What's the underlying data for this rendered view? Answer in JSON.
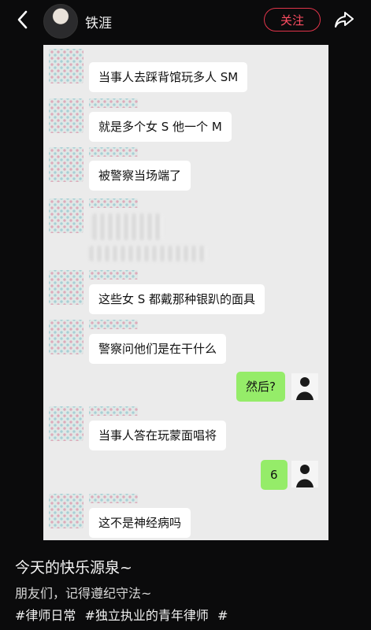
{
  "header": {
    "username": "铁涯",
    "follow_label": "关注"
  },
  "chat": {
    "messages": [
      {
        "side": "left",
        "text": "当事人去踩背馆玩多人 SM"
      },
      {
        "side": "left",
        "text": "就是多个女 S 他一个 M"
      },
      {
        "side": "left",
        "text": "被警察当场端了"
      },
      {
        "side": "left",
        "text": "",
        "blurred": true
      },
      {
        "side": "left",
        "text": "这些女 S 都戴那种银趴的面具"
      },
      {
        "side": "left",
        "text": "警察问他们是在干什么"
      },
      {
        "side": "right",
        "text": "然后?"
      },
      {
        "side": "left",
        "text": "当事人答在玩蒙面唱将"
      },
      {
        "side": "right",
        "text": "6"
      },
      {
        "side": "left",
        "text": "这不是神经病吗"
      }
    ]
  },
  "caption": {
    "title": "今天的快乐源泉~",
    "text": "朋友们，记得遵纪守法~",
    "tags": [
      "#律师日常",
      "#独立执业的青年律师",
      "#"
    ]
  },
  "colors": {
    "background": "#0b0b0c",
    "follow_accent": "#e0344a",
    "my_bubble": "#95ec69",
    "chat_bg": "#ebebeb"
  },
  "icons": [
    "back-icon",
    "share-icon"
  ]
}
